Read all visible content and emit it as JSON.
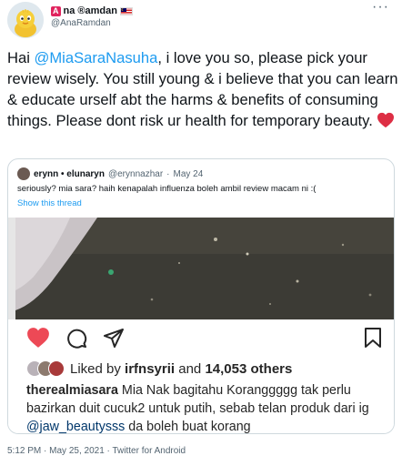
{
  "author": {
    "name_badge": "A",
    "name": "na ®amdan",
    "flag": "malaysia-flag",
    "handle": "@AnaRamdan"
  },
  "tweet": {
    "prefix": "Hai ",
    "mention": "@MiaSaraNasuha",
    "body": ", i love you so, please pick your review wisely. You still young & i believe that you can learn & educate urself abt the harms & benefits of consuming things. Please dont risk ur health for temporary beauty. ",
    "emoji": "red-heart"
  },
  "quoted": {
    "name": "erynn • elunaryn",
    "handle": "@erynnazhar",
    "separator": "·",
    "date": "May 24",
    "text": "seriously? mia sara? haih kenapalah influenza boleh ambil review macam ni :(",
    "show_thread": "Show this thread",
    "instagram": {
      "liked_by_prefix": "Liked by ",
      "liked_by_user": "irfnsyrii",
      "liked_by_and": " and ",
      "liked_by_count": "14,053 others",
      "caption_user": "therealmiasara",
      "caption_text_1": " Mia Nak bagitahu Koranggggg tak perlu bazirkan duit cucuk2 untuk putih, sebab telan produk dari ig ",
      "caption_mention": "@jaw_beautysss",
      "caption_text_2": " da boleh buat korang"
    }
  },
  "meta": {
    "time": "5:12 PM",
    "separator": "·",
    "date": "May 25, 2021",
    "source": "Twitter for Android"
  },
  "colors": {
    "link": "#1d9bf0",
    "heart": "#ed4956",
    "muted": "#536471"
  }
}
